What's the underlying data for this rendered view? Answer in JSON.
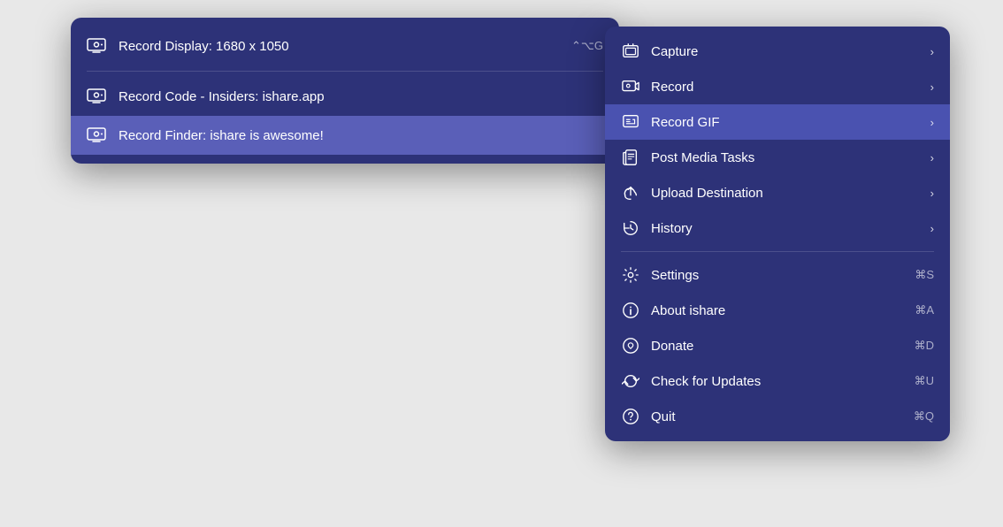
{
  "mainMenu": {
    "items": [
      {
        "id": "capture",
        "label": "Capture",
        "shortcut": null,
        "hasArrow": true,
        "iconType": "capture"
      },
      {
        "id": "record",
        "label": "Record",
        "shortcut": null,
        "hasArrow": true,
        "iconType": "record",
        "highlighted": false
      },
      {
        "id": "record-gif",
        "label": "Record GIF",
        "shortcut": null,
        "hasArrow": true,
        "iconType": "record-gif",
        "highlighted": true
      },
      {
        "id": "post-media",
        "label": "Post Media Tasks",
        "shortcut": null,
        "hasArrow": true,
        "iconType": "post-media"
      },
      {
        "id": "upload",
        "label": "Upload Destination",
        "shortcut": null,
        "hasArrow": true,
        "iconType": "upload"
      },
      {
        "id": "history",
        "label": "History",
        "shortcut": null,
        "hasArrow": true,
        "iconType": "history"
      },
      {
        "divider": true
      },
      {
        "id": "settings",
        "label": "Settings",
        "shortcut": "⌘S",
        "hasArrow": false,
        "iconType": "settings"
      },
      {
        "id": "about",
        "label": "About ishare",
        "shortcut": "⌘A",
        "hasArrow": false,
        "iconType": "info"
      },
      {
        "id": "donate",
        "label": "Donate",
        "shortcut": "⌘D",
        "hasArrow": false,
        "iconType": "donate"
      },
      {
        "id": "update",
        "label": "Check for Updates",
        "shortcut": "⌘U",
        "hasArrow": false,
        "iconType": "update"
      },
      {
        "id": "quit",
        "label": "Quit",
        "shortcut": "⌘Q",
        "hasArrow": false,
        "iconType": "quit"
      }
    ]
  },
  "subMenu": {
    "items": [
      {
        "id": "record-display",
        "label": "Record Display: 1680 x 1050",
        "shortcut": "⌃⌥G",
        "iconType": "record-screen"
      },
      {
        "divider": true
      },
      {
        "id": "record-code",
        "label": "Record Code - Insiders: ishare.app",
        "shortcut": null,
        "iconType": "record-screen"
      },
      {
        "id": "record-finder",
        "label": "Record Finder: ishare is awesome!",
        "shortcut": null,
        "iconType": "record-screen",
        "selected": true
      }
    ]
  }
}
